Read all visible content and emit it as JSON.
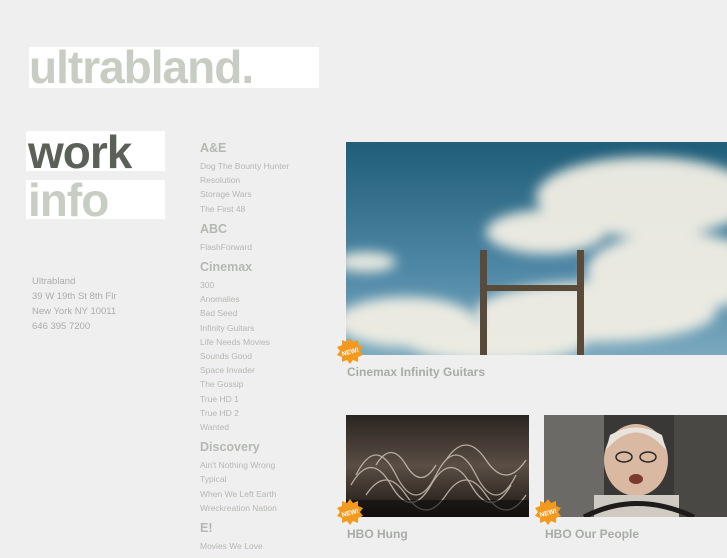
{
  "site": {
    "logo": "ultrabland."
  },
  "nav": {
    "work": "work",
    "info": "info"
  },
  "address": [
    "Ultrabland",
    "39 W 19th St 8th Flr",
    "New York NY 10011",
    "646 395 7200"
  ],
  "networks": [
    {
      "name": "A&E",
      "shows": [
        "Dog The Bounty Hunter",
        "Resolution",
        "Storage Wars",
        "The First 48"
      ]
    },
    {
      "name": "ABC",
      "shows": [
        "FlashForward"
      ]
    },
    {
      "name": "Cinemax",
      "shows": [
        "300",
        "Anomalies",
        "Bad Seed",
        "Infinity Guitars",
        "Life Needs Movies",
        "Sounds Good",
        "Space Invader",
        "The Gossip",
        "True HD 1",
        "True HD 2",
        "Wanted"
      ]
    },
    {
      "name": "Discovery",
      "shows": [
        "Ain't Nothing Wrong",
        "Typical",
        "When We Left Earth",
        "Wreckreation Nation"
      ]
    },
    {
      "name": "E!",
      "shows": [
        "Movies We Love"
      ]
    }
  ],
  "featured": {
    "caption": "Cinemax Infinity Guitars",
    "badge": "NEW!"
  },
  "thumbs": [
    {
      "caption": "HBO Hung",
      "badge": "NEW!"
    },
    {
      "caption": "HBO Our People",
      "badge": "NEW!"
    }
  ],
  "colors": {
    "background": "#efeff0",
    "badge": "#f39a1e",
    "text_muted": "#b3b8b0"
  }
}
